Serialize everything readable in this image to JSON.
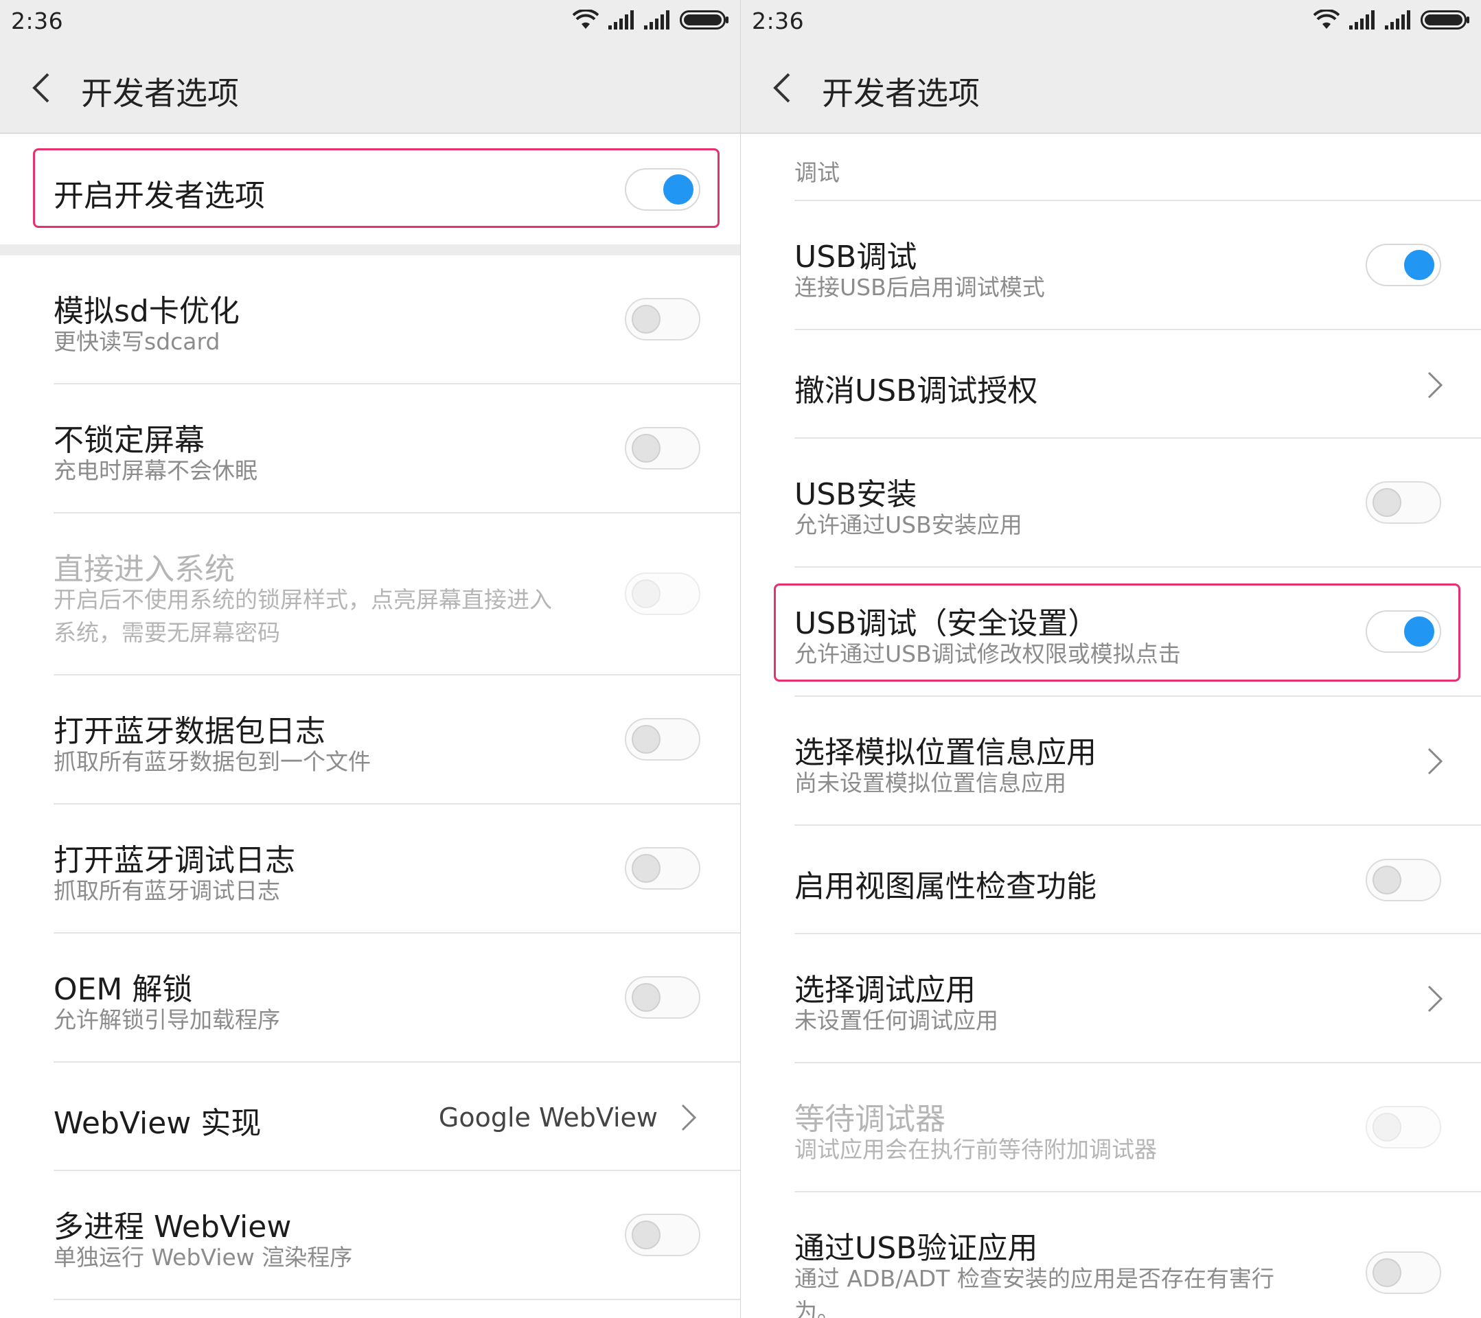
{
  "left": {
    "status_time": "2:36",
    "title": "开发者选项",
    "master": {
      "label": "开启开发者选项",
      "on": true
    },
    "items": [
      {
        "title": "模拟sd卡优化",
        "subtitle": "更快读写sdcard"
      },
      {
        "title": "不锁定屏幕",
        "subtitle": "充电时屏幕不会休眠"
      },
      {
        "title": "直接进入系统",
        "subtitle1": "开启后不使用系统的锁屏样式，点亮屏幕直接进入",
        "subtitle2": "系统，需要无屏幕密码"
      },
      {
        "title": "打开蓝牙数据包日志",
        "subtitle": "抓取所有蓝牙数据包到一个文件"
      },
      {
        "title": "打开蓝牙调试日志",
        "subtitle": "抓取所有蓝牙调试日志"
      },
      {
        "title": "OEM 解锁",
        "subtitle": "允许解锁引导加载程序"
      },
      {
        "title": "WebView 实现",
        "value": "Google WebView"
      },
      {
        "title": "多进程 WebView",
        "subtitle": "单独运行 WebView 渲染程序"
      }
    ]
  },
  "right": {
    "status_time": "2:36",
    "title": "开发者选项",
    "section": "调试",
    "items": [
      {
        "title": "USB调试",
        "subtitle": "连接USB后启用调试模式"
      },
      {
        "title": "撤消USB调试授权"
      },
      {
        "title": "USB安装",
        "subtitle": "允许通过USB安装应用"
      },
      {
        "title": "USB调试（安全设置）",
        "subtitle": "允许通过USB调试修改权限或模拟点击"
      },
      {
        "title": "选择模拟位置信息应用",
        "subtitle": "尚未设置模拟位置信息应用"
      },
      {
        "title": "启用视图属性检查功能"
      },
      {
        "title": "选择调试应用",
        "subtitle": "未设置任何调试应用"
      },
      {
        "title": "等待调试器",
        "subtitle": "调试应用会在执行前等待附加调试器"
      },
      {
        "title": "通过USB验证应用",
        "subtitle1": "通过 ADB/ADT 检查安装的应用是否存在有害行",
        "subtitle2": "为。"
      }
    ]
  },
  "colors": {
    "accent": "#2196f3",
    "highlight": "#e8306f",
    "header_bg": "#ededed"
  },
  "icons": [
    "wifi-icon",
    "signal-icon",
    "battery-icon",
    "back-arrow-icon",
    "chevron-right-icon"
  ]
}
